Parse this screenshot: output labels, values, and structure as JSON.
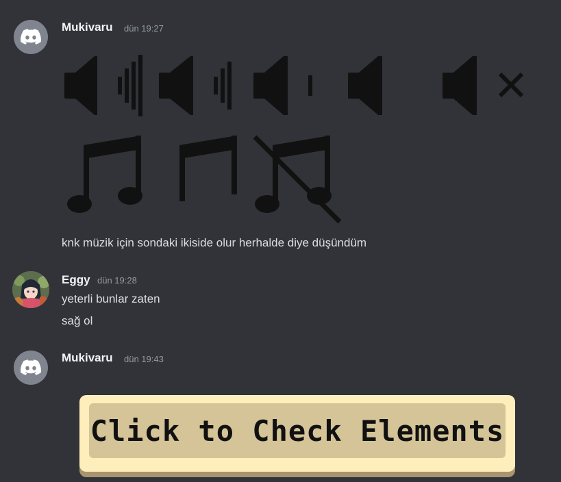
{
  "messages": [
    {
      "username": "Mukivaru",
      "timestamp": "dün 19:27",
      "avatar": "discord-logo",
      "lines": [
        "knk müzik için sondaki ikiside olur herhalde diye düşündüm"
      ]
    },
    {
      "username": "Eggy",
      "timestamp": "dün 19:28",
      "avatar": "anime-avatar",
      "lines": [
        "yeterli bunlar zaten",
        "sağ ol"
      ]
    },
    {
      "username": "Mukivaru",
      "timestamp": "dün 19:43",
      "avatar": "discord-logo",
      "lines": []
    }
  ],
  "attachment": {
    "icons": [
      "speaker-high-icon",
      "speaker-medium-icon",
      "speaker-low-icon",
      "speaker-no-waves-icon",
      "speaker-mute-icon",
      "music-note-icon",
      "music-note-empty-icon",
      "music-note-off-icon"
    ]
  },
  "cta": {
    "label": "Click to Check Elements"
  },
  "colors": {
    "background": "#313338",
    "username": "#f2f3f5",
    "text": "#dbdee1",
    "timestamp": "#949ba4",
    "cta_face": "#d4c498",
    "cta_border": "#fdeebc"
  }
}
